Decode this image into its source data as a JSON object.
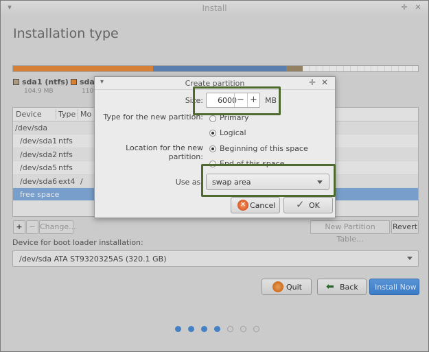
{
  "window": {
    "title": "Install"
  },
  "page_title": "Installation type",
  "partition_bar": {
    "segments": [
      {
        "color": "#e2873a",
        "fraction": 0.345
      },
      {
        "color": "#5f86b8",
        "fraction": 0.33
      },
      {
        "color": "#9a8868",
        "fraction": 0.04
      },
      {
        "color": "#f2f2f2",
        "fraction": 0.285
      }
    ]
  },
  "legend": [
    {
      "name": "sda1 (ntfs)",
      "size": "104.9 MB",
      "color": "#b4a48a"
    },
    {
      "name": "sda",
      "size": "110",
      "color": "#e2873a"
    }
  ],
  "table": {
    "columns": [
      "Device",
      "Type",
      "Mo"
    ],
    "rows": [
      {
        "device": "/dev/sda",
        "type": "",
        "mount": ""
      },
      {
        "device": "/dev/sda1",
        "type": "ntfs",
        "mount": ""
      },
      {
        "device": "/dev/sda2",
        "type": "ntfs",
        "mount": ""
      },
      {
        "device": "/dev/sda5",
        "type": "ntfs",
        "mount": ""
      },
      {
        "device": "/dev/sda6",
        "type": "ext4",
        "mount": "/"
      },
      {
        "device": "free space",
        "type": "",
        "mount": ""
      }
    ]
  },
  "table_buttons": {
    "add": "+",
    "remove": "−",
    "change": "Change...",
    "new_table": "New Partition Table...",
    "revert": "Revert"
  },
  "boot": {
    "label": "Device for boot loader installation:",
    "value": "/dev/sda   ATA ST9320325AS (320.1 GB)"
  },
  "nav": {
    "quit": "Quit",
    "back": "Back",
    "install": "Install Now"
  },
  "steps": {
    "total": 7,
    "completed": 4
  },
  "dialog": {
    "title": "Create partition",
    "size_label": "Size:",
    "size_value": "6000",
    "size_unit": "MB",
    "minus": "−",
    "plus": "+",
    "type_label": "Type for the new partition:",
    "type_options": [
      "Primary",
      "Logical"
    ],
    "location_label": "Location for the new partition:",
    "location_options": [
      "Beginning of this space",
      "End of this space"
    ],
    "use_as_label": "Use as:",
    "use_as_value": "swap area",
    "cancel": "Cancel",
    "ok": "OK"
  },
  "colors": {
    "accent": "#4a87cf",
    "highlight_box": "#4f6a2f",
    "selection": "#7fa8d6"
  }
}
